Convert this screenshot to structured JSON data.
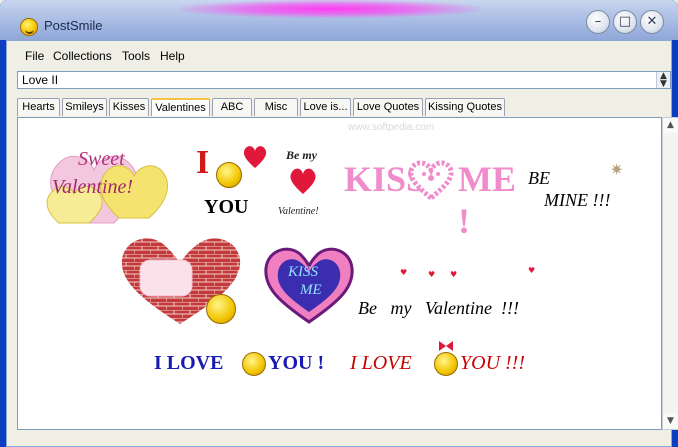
{
  "window": {
    "title": "PostSmile"
  },
  "menu": [
    "File",
    "Collections",
    "Tools",
    "Help"
  ],
  "combo": {
    "value": "Love II"
  },
  "tabs": [
    "Hearts",
    "Smileys",
    "Kisses",
    "Valentines",
    "ABC",
    "Misc",
    "Love is...",
    "Love Quotes",
    "Kissing Quotes"
  ],
  "active_tab": "Valentines",
  "watermark": "www.softpedia.com",
  "gallery": {
    "sweet": [
      "Sweet",
      "Valentine!"
    ],
    "i_you": [
      "I",
      "YOU"
    ],
    "be_my": [
      "Be my",
      "Valentine!"
    ],
    "kiss_me": [
      "KISS",
      "ME !"
    ],
    "be_mine": [
      "BE",
      "MINE !!!"
    ],
    "kiss_me_heart": [
      "KISS",
      "ME"
    ],
    "be_my_valentine": "Be   my   Valentine  !!!",
    "love_line_1": [
      "I LOVE",
      "YOU !"
    ],
    "love_line_2": [
      "I LOVE",
      "YOU !!!"
    ]
  },
  "colors": {
    "titlebar": "#b5c6e8",
    "active_tab_accent": "#f6c144",
    "heart_pink": "#ef7fc0",
    "heart_red": "#e0183a"
  }
}
